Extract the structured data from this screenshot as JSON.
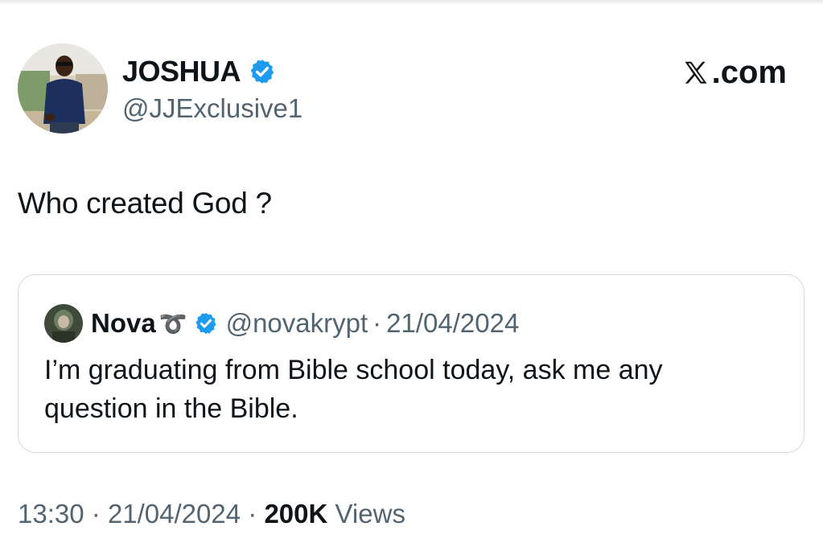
{
  "author": {
    "name": "JOSHUA",
    "handle": "@JJExclusive1",
    "verified": true
  },
  "brand": {
    "logo_icon": "x-logo-icon",
    "label": ".com"
  },
  "tweet": {
    "text": "Who created God ?"
  },
  "quote": {
    "name": "Nova",
    "name_emoji": "➰",
    "handle": "@novakrypt",
    "separator": "·",
    "date": "21/04/2024",
    "text": "I’m graduating from Bible school today, ask me any question in the Bible."
  },
  "meta": {
    "time": "13:30",
    "sep1": "·",
    "date": "21/04/2024",
    "sep2": "·",
    "views_count": "200K",
    "views_label": "Views"
  },
  "colors": {
    "verified": "#1d9bf0",
    "secondary_text": "#536471",
    "border": "#cfd9de"
  }
}
